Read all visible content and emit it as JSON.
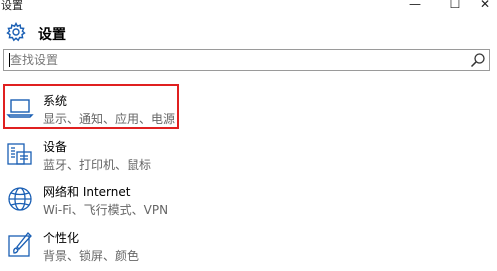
{
  "window": {
    "title": "设置",
    "minimize_glyph": "—",
    "maximize_glyph": "☐",
    "close_glyph": "✕"
  },
  "header": {
    "title": "设置",
    "icon": "gear-icon"
  },
  "search": {
    "placeholder": "查找设置",
    "icon": "search-icon"
  },
  "highlight_color": "#e02020",
  "items": [
    {
      "title": "系统",
      "subtitle": "显示、通知、应用、电源",
      "icon": "laptop-icon"
    },
    {
      "title": "设备",
      "subtitle": "蓝牙、打印机、鼠标",
      "icon": "keyboard-printer-icon"
    },
    {
      "title": "网络和 Internet",
      "subtitle": "Wi-Fi、飞行模式、VPN",
      "icon": "globe-icon"
    },
    {
      "title": "个性化",
      "subtitle": "背景、锁屏、颜色",
      "icon": "paint-brush-icon"
    }
  ]
}
